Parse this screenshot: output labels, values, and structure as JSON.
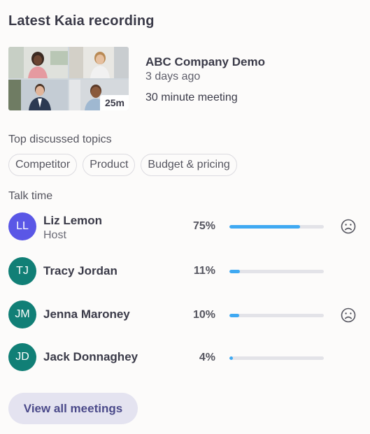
{
  "header": {
    "title": "Latest Kaia recording"
  },
  "recording": {
    "duration": "25m",
    "title": "ABC Company Demo",
    "ago": "3 days ago",
    "length": "30 minute meeting"
  },
  "topics": {
    "label": "Top discussed topics",
    "items": [
      "Competitor",
      "Product",
      "Budget & pricing"
    ]
  },
  "talk_time": {
    "label": "Talk time",
    "participants": [
      {
        "initials": "LL",
        "name": "Liz Lemon",
        "role": "Host",
        "percent_label": "75%",
        "percent": 75,
        "avatar_color": "#5a57e6",
        "sentiment_icon": "sad-face-icon"
      },
      {
        "initials": "TJ",
        "name": "Tracy Jordan",
        "role": "",
        "percent_label": "11%",
        "percent": 11,
        "avatar_color": "#117f76",
        "sentiment_icon": ""
      },
      {
        "initials": "JM",
        "name": "Jenna Maroney",
        "role": "",
        "percent_label": "10%",
        "percent": 10,
        "avatar_color": "#117f76",
        "sentiment_icon": "sad-face-icon"
      },
      {
        "initials": "JD",
        "name": "Jack Donnaghey",
        "role": "",
        "percent_label": "4%",
        "percent": 4,
        "avatar_color": "#117f76",
        "sentiment_icon": ""
      }
    ]
  },
  "actions": {
    "view_all": "View all meetings"
  },
  "colors": {
    "accent_bar": "#3fa9f2",
    "track": "#e3e3e8",
    "button_bg": "#e4e3f0",
    "button_text": "#4b4a8a"
  }
}
